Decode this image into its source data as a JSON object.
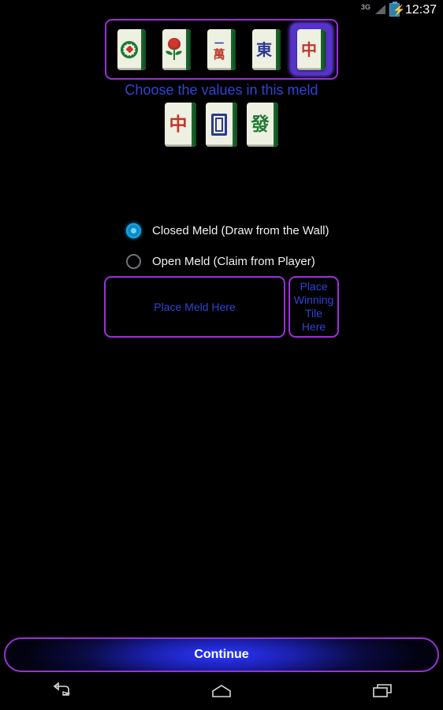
{
  "status_bar": {
    "network_label": "3G",
    "signal_icon": "signal-bars-icon",
    "battery_icon": "battery-charging-icon",
    "time": "12:37"
  },
  "tile_selector": {
    "name": "tile-value-selector",
    "options": [
      {
        "id": "circles-1",
        "icon": "dot-tile-icon",
        "label": "",
        "type": "dot",
        "selected": false
      },
      {
        "id": "flower",
        "icon": "flower-tile-icon",
        "label": "",
        "type": "flower",
        "selected": false
      },
      {
        "id": "characters-1",
        "icon": "character-tile-icon",
        "label": "一萬",
        "type": "stack",
        "top": "一",
        "bottom": "萬",
        "selected": false
      },
      {
        "id": "east-wind",
        "icon": "east-wind-tile-icon",
        "label": "東",
        "type": "glyph",
        "color": "blue",
        "selected": false
      },
      {
        "id": "red-dragon",
        "icon": "red-dragon-tile-icon",
        "label": "中",
        "type": "glyph",
        "color": "red",
        "selected": true
      }
    ]
  },
  "prompt": {
    "text": "Choose the values in this meld"
  },
  "current_meld": {
    "name": "current-meld-row",
    "tiles": [
      {
        "id": "red-dragon",
        "icon": "red-dragon-tile-icon",
        "label": "中",
        "type": "glyph",
        "color": "red"
      },
      {
        "id": "white-dragon",
        "icon": "white-dragon-tile-icon",
        "label": "",
        "type": "whitedragon"
      },
      {
        "id": "green-dragon",
        "icon": "green-dragon-tile-icon",
        "label": "發",
        "type": "glyph",
        "color": "green"
      }
    ]
  },
  "meld_type": {
    "options": [
      {
        "id": "closed",
        "label": "Closed Meld (Draw from the Wall)",
        "selected": true
      },
      {
        "id": "open",
        "label": "Open Meld (Claim from Player)",
        "selected": false
      }
    ]
  },
  "drop_zones": {
    "meld": "Place Meld Here",
    "winning_tile": "Place Winning Tile Here"
  },
  "footer": {
    "continue_label": "Continue"
  },
  "nav_bar": {
    "back": "back-icon",
    "home": "home-icon",
    "recents": "recents-icon"
  },
  "colors": {
    "accent_purple": "#9b30d9",
    "accent_blue": "#2f44d6",
    "radio_on": "#0d89c4",
    "tile_face": "#eef0e2",
    "tile_edge_green": "#1f6b30"
  }
}
